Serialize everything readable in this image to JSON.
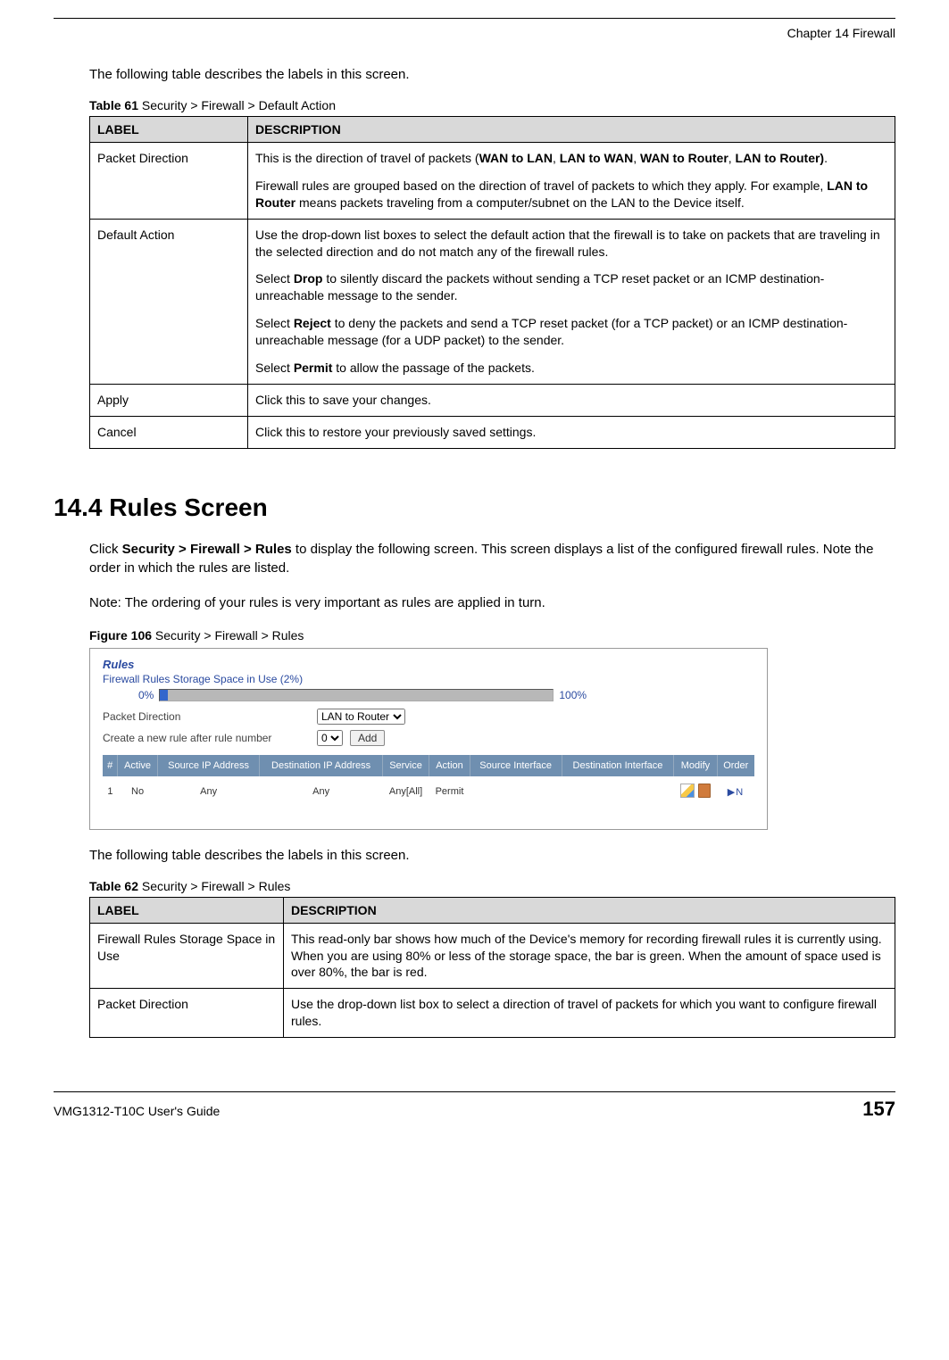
{
  "header": {
    "chapter": "Chapter 14 Firewall"
  },
  "intro1": "The following table describes the labels in this screen.",
  "table61": {
    "caption_bold": "Table 61",
    "caption_rest": "   Security > Firewall > Default Action",
    "head_label": "LABEL",
    "head_desc": "DESCRIPTION",
    "rows": [
      {
        "label": "Packet Direction",
        "paras": [
          {
            "pre": "This is the direction of travel of packets (",
            "b1": "WAN to LAN",
            "mid1": ", ",
            "b2": "LAN to WAN",
            "mid2": ", ",
            "b3": "WAN to Router",
            "mid3": ", ",
            "b4": "LAN to Router)",
            "post": "."
          },
          {
            "pre": "Firewall rules are grouped based on the direction of travel of packets to which they apply. For example, ",
            "b1": "LAN to Router",
            "post": " means packets traveling from a computer/subnet on the LAN to the Device itself."
          }
        ]
      },
      {
        "label": "Default Action",
        "paras": [
          {
            "pre": "Use the drop-down list boxes to select the default action that the firewall is to take on packets that are traveling in the selected direction and do not match any of the firewall rules."
          },
          {
            "pre": "Select ",
            "b1": "Drop",
            "post": " to silently discard the packets without sending a TCP reset packet or an ICMP destination-unreachable message to the sender."
          },
          {
            "pre": "Select ",
            "b1": "Reject",
            "post": " to deny the packets and send a TCP reset packet (for a TCP packet) or an ICMP destination-unreachable message (for a UDP packet) to the sender."
          },
          {
            "pre": "Select ",
            "b1": "Permit",
            "post": " to allow the passage of the packets."
          }
        ]
      },
      {
        "label": "Apply",
        "paras": [
          {
            "pre": "Click this to save your changes."
          }
        ]
      },
      {
        "label": "Cancel",
        "paras": [
          {
            "pre": "Click this to restore your previously saved settings."
          }
        ]
      }
    ]
  },
  "section": {
    "heading": "14.4  Rules Screen",
    "p1_pre": "Click ",
    "p1_b": "Security > Firewall > Rules",
    "p1_post": " to display the following screen. This screen displays a list of the configured firewall rules. Note the order in which the rules are listed.",
    "note": "Note: The ordering of your rules is very important as rules are applied in turn."
  },
  "figure": {
    "caption_bold": "Figure 106",
    "caption_rest": "   Security > Firewall > Rules",
    "rules_title": "Rules",
    "storage_label": "Firewall Rules Storage Space in Use (2%)",
    "pct_left": "0%",
    "pct_right": "100%",
    "packet_dir_label": "Packet Direction",
    "packet_dir_value": "LAN to Router",
    "create_rule_label": "Create a new rule after rule number",
    "create_rule_value": "0",
    "add_button": "Add",
    "cols": [
      "#",
      "Active",
      "Source IP Address",
      "Destination IP Address",
      "Service",
      "Action",
      "Source Interface",
      "Destination Interface",
      "Modify",
      "Order"
    ],
    "row": {
      "num": "1",
      "active": "No",
      "src": "Any",
      "dst": "Any",
      "service": "Any[All]",
      "action": "Permit",
      "srcif": "",
      "dstif": "",
      "order": "▶N"
    }
  },
  "intro2": "The following table describes the labels in this screen.",
  "table62": {
    "caption_bold": "Table 62",
    "caption_rest": "   Security > Firewall > Rules",
    "head_label": "LABEL",
    "head_desc": "DESCRIPTION",
    "rows": [
      {
        "label": "Firewall Rules Storage Space in Use",
        "desc": "This read-only bar shows how much of the Device's memory for recording firewall rules it is currently using. When you are using 80% or less of the storage space, the bar is green. When the amount of space used is over 80%, the bar is red."
      },
      {
        "label": "Packet Direction",
        "desc": "Use the drop-down list box to select a direction of travel of packets for which you want to configure firewall rules."
      }
    ]
  },
  "footer": {
    "guide": "VMG1312-T10C User's Guide",
    "page": "157"
  }
}
